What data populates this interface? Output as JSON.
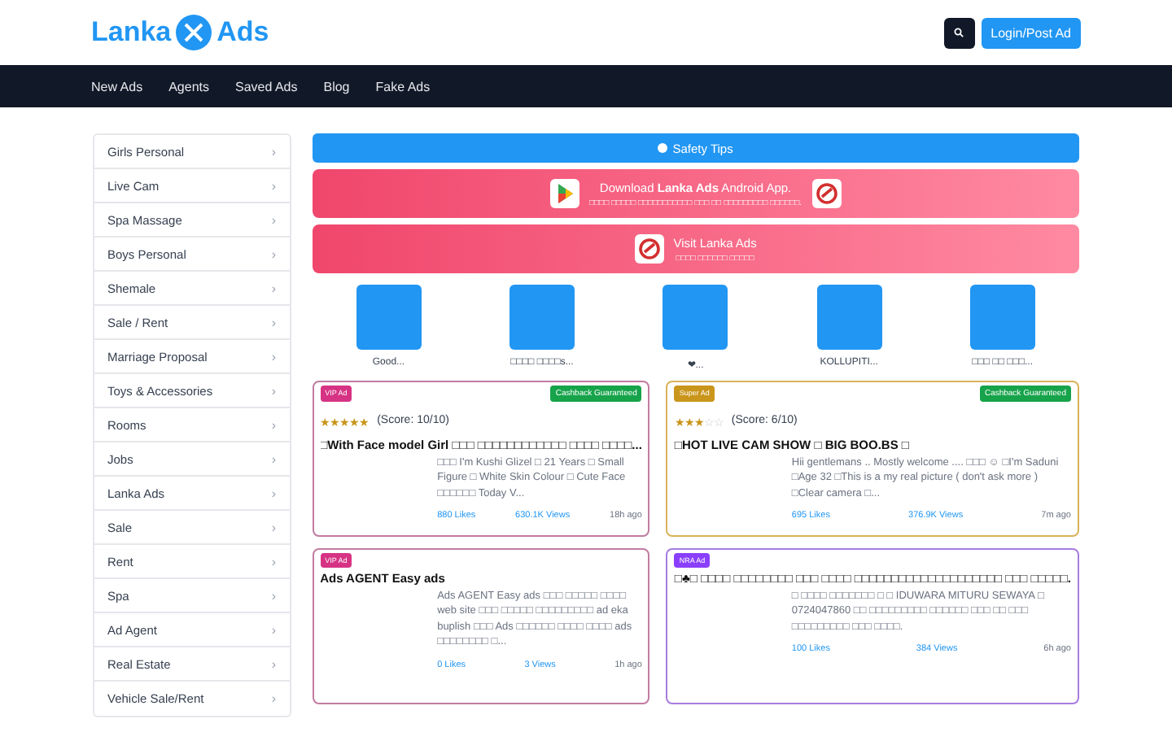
{
  "header": {
    "logo_left": "Lanka",
    "logo_right": "Ads",
    "login_button": "Login/Post Ad"
  },
  "nav": [
    "New Ads",
    "Agents",
    "Saved Ads",
    "Blog",
    "Fake Ads"
  ],
  "sidebar": {
    "items": [
      {
        "label": "Girls Personal",
        "arrow": "›"
      },
      {
        "label": "Live Cam",
        "arrow": "›"
      },
      {
        "label": "Spa Massage",
        "arrow": "›"
      },
      {
        "label": "Boys Personal",
        "arrow": "›"
      },
      {
        "label": "Shemale",
        "arrow": "›"
      },
      {
        "label": "Sale / Rent",
        "arrow": "›"
      },
      {
        "label": "Marriage Proposal",
        "arrow": "›"
      },
      {
        "label": "Toys & Accessories",
        "arrow": "›"
      },
      {
        "label": "Rooms",
        "arrow": "›"
      },
      {
        "label": "Jobs",
        "arrow": "›"
      },
      {
        "label": "Lanka Ads",
        "arrow": "›"
      },
      {
        "label": "Sale",
        "arrow": "›"
      },
      {
        "label": "Rent",
        "arrow": "›"
      },
      {
        "label": "Spa",
        "arrow": "›"
      },
      {
        "label": "Ad Agent",
        "arrow": "›"
      },
      {
        "label": "Real Estate",
        "arrow": "›"
      },
      {
        "label": "Vehicle Sale/Rent",
        "arrow": "›"
      }
    ]
  },
  "safety_tips": "Safety Tips",
  "download_banner": {
    "title": "Download **Lanka Ads** Android App.",
    "subtitle": "□□□□ □□□□□ □□□□□□□□□□□ □□□ □□ □□□□□□□□□ □□□□□□."
  },
  "visit_banner": {
    "title": "Visit Lanka Ads",
    "subtitle": "□□□□ □□□□□□ □□□□□"
  },
  "stories": [
    "Good...",
    "□□□□ □□□□s...",
    "❤...",
    "KOLLUPITI...",
    "□□□ □□ □□□..."
  ],
  "ads": [
    {
      "tag": "VIP Ad",
      "kind": "vip",
      "cashback": "Cashback Guaranteed",
      "stars": 5,
      "score": "(Score: 10/10)",
      "title": "□With Face model Girl □□□ □□□□□□□□□□□□ □□□□ □□□□...",
      "description": "□□□ I'm Kushi Glizel □ 21 Years □ Small Figure □ White Skin Colour □ Cute Face □□□□□□ Today V...",
      "likes": "880 Likes",
      "views": "630.1K Views",
      "time": "18h ago"
    },
    {
      "tag": "Super Ad",
      "kind": "super",
      "cashback": "Cashback Guaranteed",
      "stars": 3,
      "score": "(Score: 6/10)",
      "title": "□HOT LIVE CAM SHOW □ BIG BOO.BS □",
      "description": "Hii gentlemans .. Mostly welcome .... □□□ ☺ □I'm Saduni □Age 32 □This is a my real picture ( don't ask more ) □Clear camera □...",
      "likes": "695 Likes",
      "views": "376.9K Views",
      "time": "7m ago"
    },
    {
      "tag": "VIP Ad",
      "kind": "vip",
      "title": "Ads AGENT Easy ads",
      "description": "Ads AGENT Easy ads □□□ □□□□□ □□□□ web site □□□ □□□□□ □□□□□□□□□ ad eka buplish □□□ Ads □□□□□□ □□□□ □□□□ ads □□□□□□□□ □...",
      "likes": "0 Likes",
      "views": "3 Views",
      "time": "1h ago"
    },
    {
      "tag": "NRA Ad",
      "kind": "nra",
      "title": "□♣□ □□□□ □□□□□□□□ □□□ □□□□ □□□□□□□□□□□□□□□□□□□□ □□□ □□□□□.",
      "description": "□ □□□□ □□□□□□□ □ □ IDUWARA MITURU SEWAYA □ 0724047860 □□ □□□□□□□□□ □□□□□□ □□□ □□ □□□ □□□□□□□□□ □□□ □□□□.",
      "likes": "100 Likes",
      "views": "384 Views",
      "time": "6h ago"
    }
  ]
}
